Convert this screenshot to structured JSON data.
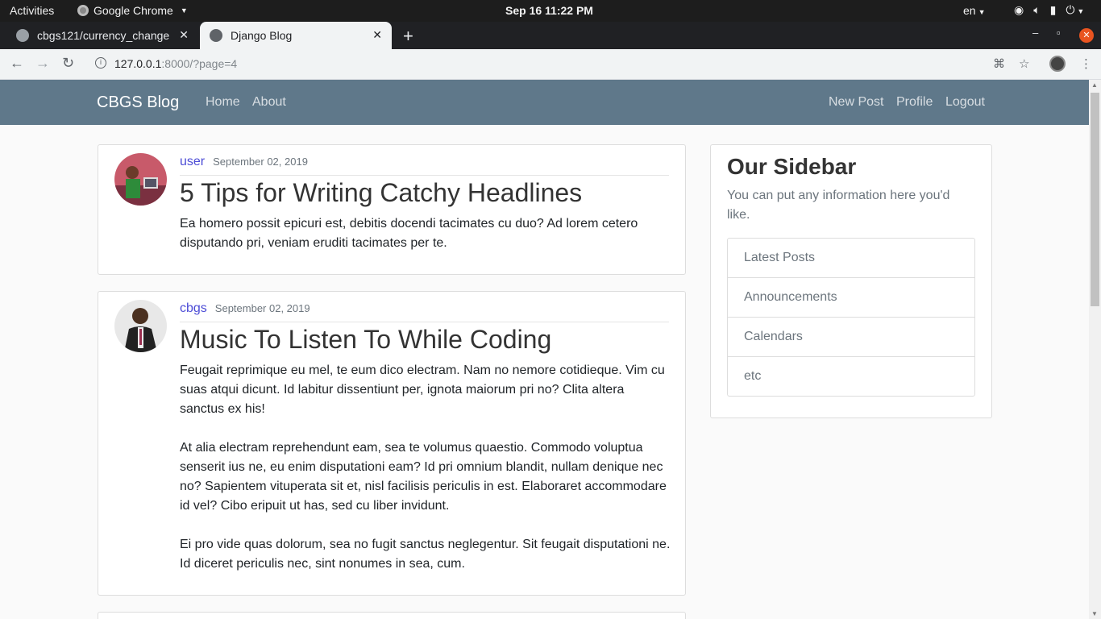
{
  "os_bar": {
    "activities": "Activities",
    "app_name": "Google Chrome",
    "clock": "Sep 16  11:22 PM",
    "language": "en",
    "tray_icons": [
      "wifi-icon",
      "volume-icon",
      "battery-icon",
      "power-icon"
    ]
  },
  "browser": {
    "tabs": [
      {
        "label": "cbgs121/currency_change",
        "icon": "github-icon",
        "active": false
      },
      {
        "label": "Django Blog",
        "icon": "globe-icon",
        "active": true
      }
    ],
    "url_host": "127.0.0.1",
    "url_rest": ":8000/?page=4"
  },
  "site": {
    "brand": "CBGS Blog",
    "nav_left": [
      "Home",
      "About"
    ],
    "nav_right": [
      "New Post",
      "Profile",
      "Logout"
    ]
  },
  "posts": [
    {
      "author": "user",
      "date": "September 02, 2019",
      "title": "5 Tips for Writing Catchy Headlines",
      "paragraphs": [
        "Ea homero possit epicuri est, debitis docendi tacimates cu duo? Ad lorem cetero disputando pri, veniam eruditi tacimates per te."
      ]
    },
    {
      "author": "cbgs",
      "date": "September 02, 2019",
      "title": "Music To Listen To While Coding",
      "paragraphs": [
        "Feugait reprimique eu mel, te eum dico electram. Nam no nemore cotidieque. Vim cu suas atqui dicunt. Id labitur dissentiunt per, ignota maiorum pri no? Clita altera sanctus ex his!",
        "At alia electram reprehendunt eam, sea te volumus quaestio. Commodo voluptua senserit ius ne, eu enim disputationi eam? Id pri omnium blandit, nullam denique nec no? Sapientem vituperata sit et, nisl facilisis periculis in est. Elaboraret accommodare id vel? Cibo eripuit ut has, sed cu liber invidunt.",
        "Ei pro vide quas dolorum, sea no fugit sanctus neglegentur. Sit feugait disputationi ne. Id diceret periculis nec, sint nonumes in sea, cum."
      ]
    }
  ],
  "sidebar": {
    "title": "Our Sidebar",
    "text": "You can put any information here you'd like.",
    "items": [
      "Latest Posts",
      "Announcements",
      "Calendars",
      "etc"
    ]
  }
}
